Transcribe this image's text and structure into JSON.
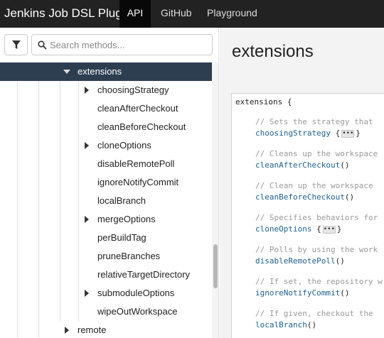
{
  "navbar": {
    "brand": "Jenkins Job DSL Plugin",
    "items": [
      {
        "label": "API",
        "active": true
      },
      {
        "label": "GitHub",
        "active": false
      },
      {
        "label": "Playground",
        "active": false
      }
    ]
  },
  "sidebar": {
    "filter_icon": "filter-icon",
    "search": {
      "placeholder": "Search methods...",
      "value": ""
    },
    "tree": {
      "selected": "extensions",
      "parent": "extensions",
      "children": [
        {
          "label": "choosingStrategy",
          "expandable": true
        },
        {
          "label": "cleanAfterCheckout",
          "expandable": false
        },
        {
          "label": "cleanBeforeCheckout",
          "expandable": false
        },
        {
          "label": "cloneOptions",
          "expandable": true
        },
        {
          "label": "disableRemotePoll",
          "expandable": false
        },
        {
          "label": "ignoreNotifyCommit",
          "expandable": false
        },
        {
          "label": "localBranch",
          "expandable": false
        },
        {
          "label": "mergeOptions",
          "expandable": true
        },
        {
          "label": "perBuildTag",
          "expandable": false
        },
        {
          "label": "pruneBranches",
          "expandable": false
        },
        {
          "label": "relativeTargetDirectory",
          "expandable": false
        },
        {
          "label": "submoduleOptions",
          "expandable": true
        },
        {
          "label": "wipeOutWorkspace",
          "expandable": false
        }
      ],
      "sibling": "remote"
    }
  },
  "content": {
    "title": "extensions",
    "code": {
      "open": "extensions {",
      "entries": [
        {
          "comment": "// Sets the strategy that",
          "method": "choosingStrategy",
          "suffix": "block",
          "ellipsis": "•••"
        },
        {
          "comment": "// Cleans up the workspace",
          "method": "cleanAfterCheckout",
          "suffix": "()"
        },
        {
          "comment": "// Clean up the workspace",
          "method": "cleanBeforeCheckout",
          "suffix": "()"
        },
        {
          "comment": "// Specifies behaviors for",
          "method": "cloneOptions",
          "suffix": "block",
          "ellipsis": "•••"
        },
        {
          "comment": "// Polls by using the work",
          "method": "disableRemotePoll",
          "suffix": "()"
        },
        {
          "comment": "// If set, the repository w",
          "method": "ignoreNotifyCommit",
          "suffix": "()"
        },
        {
          "comment": "// If given, checkout the",
          "method": "localBranch",
          "suffix": "()"
        }
      ]
    }
  },
  "colors": {
    "navbar_bg": "#222222",
    "selected_row": "#2c3e50",
    "method_link": "#1d5f90",
    "comment": "#9a9a9a"
  }
}
